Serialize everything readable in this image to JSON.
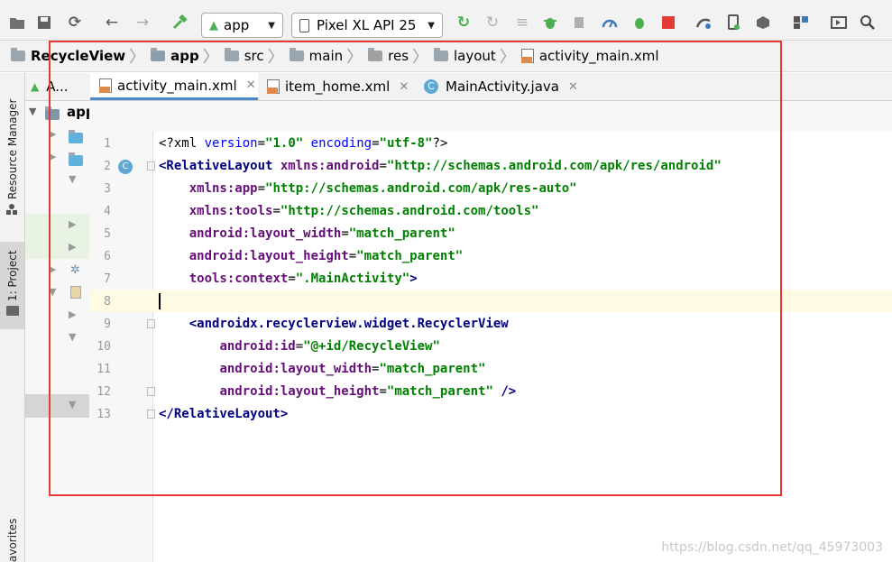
{
  "toolbar": {
    "run_config": "app",
    "device": "Pixel XL API 25",
    "icons": [
      "open-folder-icon",
      "save-icon",
      "sync-icon",
      "back-icon",
      "forward-icon",
      "build-hammer-icon",
      "run-icon",
      "apply-changes-icon",
      "apply-code-changes-icon",
      "debug-icon",
      "attach-debugger-icon",
      "profile-icon",
      "coverage-icon",
      "stop-icon",
      "gradle-sync-icon",
      "avd-manager-icon",
      "sdk-manager-icon",
      "project-structure-icon",
      "layout-inspector-icon",
      "search-icon"
    ],
    "colors": {
      "run": "#4caf50",
      "debug": "#4caf50",
      "stop": "#e53935"
    }
  },
  "breadcrumb": [
    {
      "label": "RecycleView",
      "bold": true
    },
    {
      "label": "app",
      "bold": true
    },
    {
      "label": "src"
    },
    {
      "label": "main"
    },
    {
      "label": "res"
    },
    {
      "label": "layout"
    },
    {
      "label": "activity_main.xml"
    }
  ],
  "tabs": [
    {
      "label": "A...",
      "active": false
    },
    {
      "label": "activity_main.xml",
      "active": true
    },
    {
      "label": "item_home.xml",
      "active": false
    },
    {
      "label": "MainActivity.java",
      "active": false
    }
  ],
  "left_strip": {
    "resource_manager": "Resource Manager",
    "project": "1: Project",
    "favorites": "avorites"
  },
  "project_panel": {
    "root": "app"
  },
  "editor": {
    "current_line": 8,
    "line_numbers": [
      "1",
      "2",
      "3",
      "4",
      "5",
      "6",
      "7",
      "8",
      "9",
      "10",
      "11",
      "12",
      "13"
    ],
    "lines": [
      "<?xml version=\"1.0\" encoding=\"utf-8\"?>",
      "<RelativeLayout xmlns:android=\"http://schemas.android.com/apk/res/android\"",
      "    xmlns:app=\"http://schemas.android.com/apk/res-auto\"",
      "    xmlns:tools=\"http://schemas.android.com/tools\"",
      "    android:layout_width=\"match_parent\"",
      "    android:layout_height=\"match_parent\"",
      "    tools:context=\".MainActivity\">",
      "",
      "    <androidx.recyclerview.widget.RecyclerView",
      "        android:id=\"@+id/RecycleView\"",
      "        android:layout_width=\"match_parent\"",
      "        android:layout_height=\"match_parent\" />",
      "</RelativeLayout>"
    ]
  },
  "watermark": "https://blog.csdn.net/qq_45973003"
}
